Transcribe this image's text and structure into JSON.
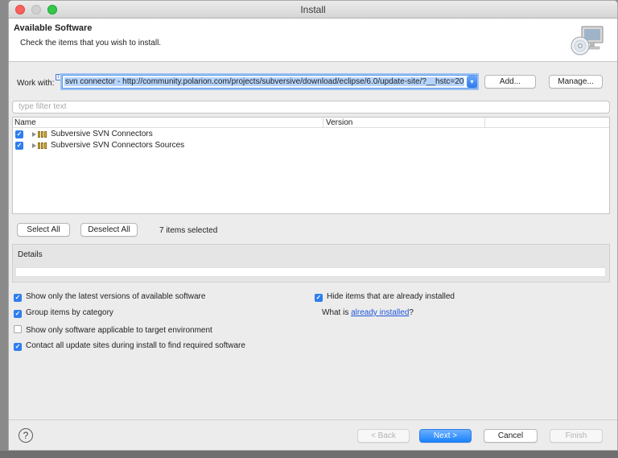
{
  "window": {
    "title": "Install"
  },
  "header": {
    "title": "Available Software",
    "description": "Check the items that you wish to install.",
    "icon": "install-cd-monitor-icon"
  },
  "work_with": {
    "label": "Work with:",
    "value": "svn connector - http://community.polarion.com/projects/subversive/download/eclipse/6.0/update-site/?__hstc=20",
    "add_label": "Add...",
    "manage_label": "Manage..."
  },
  "filter": {
    "placeholder": "type filter text"
  },
  "tree": {
    "columns": [
      "Name",
      "Version"
    ],
    "items": [
      {
        "label": "Subversive SVN Connectors",
        "checked": true,
        "version": ""
      },
      {
        "label": "Subversive SVN Connectors Sources",
        "checked": true,
        "version": ""
      }
    ]
  },
  "selection": {
    "select_all_label": "Select All",
    "deselect_all_label": "Deselect All",
    "status": "7 items selected"
  },
  "details": {
    "label": "Details"
  },
  "options": {
    "latest_versions": {
      "label": "Show only the latest versions of available software",
      "checked": true
    },
    "group_by_category": {
      "label": "Group items by category",
      "checked": true
    },
    "target_env": {
      "label": "Show only software applicable to target environment",
      "checked": false
    },
    "contact_sites": {
      "label": "Contact all update sites during install to find required software",
      "checked": true
    },
    "hide_installed": {
      "label": "Hide items that are already installed",
      "checked": true
    },
    "what_is_prefix": "What is ",
    "what_is_link": "already installed",
    "what_is_suffix": "?"
  },
  "footer": {
    "back_label": "< Back",
    "next_label": "Next >",
    "cancel_label": "Cancel",
    "finish_label": "Finish",
    "help_icon": "help-icon"
  },
  "colors": {
    "accent": "#2f7def",
    "link": "#1f56d8"
  }
}
